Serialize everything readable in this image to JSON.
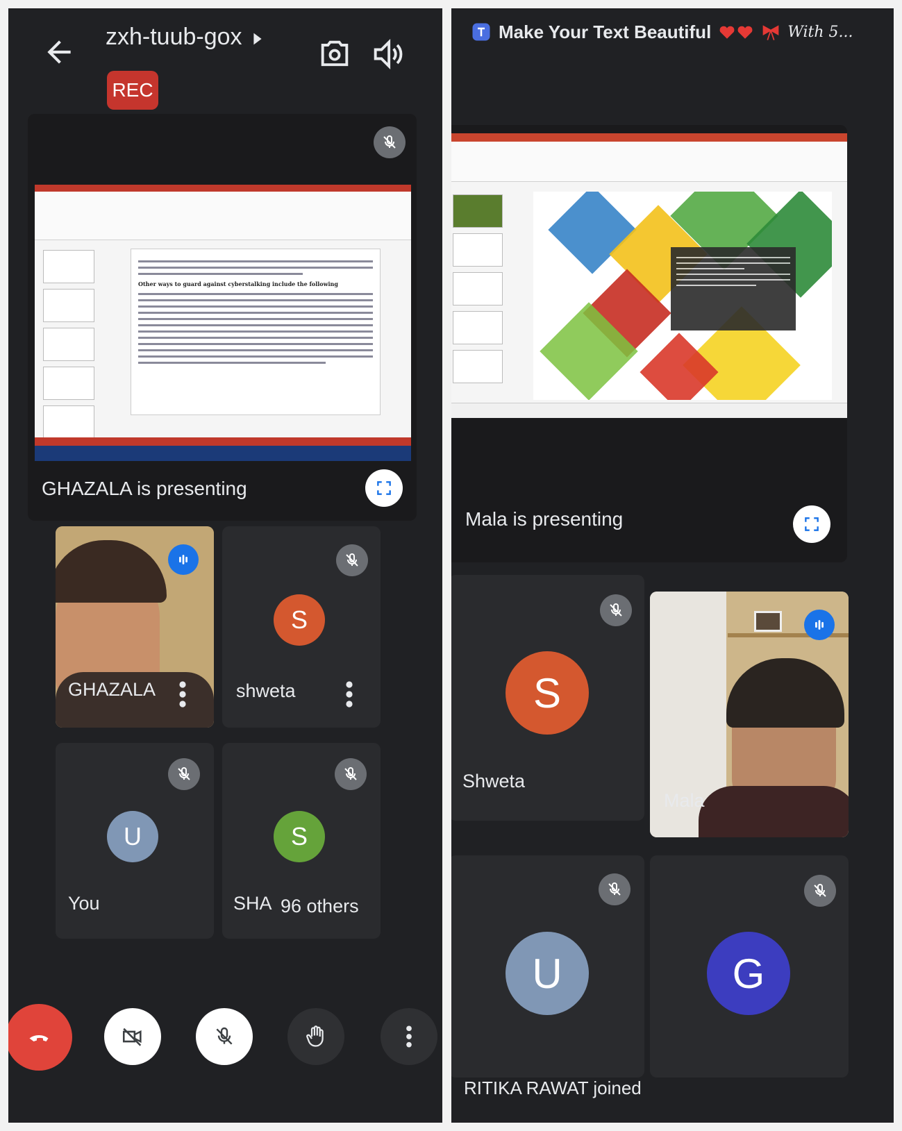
{
  "left": {
    "meeting_code": "zxh-tuub-gox",
    "rec_label": "REC",
    "presenting_label": "GHAZALA is presenting",
    "tiles": [
      {
        "name": "GHAZALA"
      },
      {
        "name": "shweta",
        "initial": "S",
        "color": "#d4582f"
      },
      {
        "name": "You",
        "initial": "U",
        "color": "#8097b5"
      },
      {
        "name": "SHA",
        "initial": "S",
        "color": "#65a33a",
        "others": "96 others"
      }
    ],
    "doc_heading": "Other ways to guard against cyberstalking include the following"
  },
  "right": {
    "notification_text": "Make Your Text Beautiful",
    "notification_extra": "With 5...",
    "presenting_label": "Mala is presenting",
    "tiles": [
      {
        "name": "Shweta",
        "initial": "S",
        "color": "#d4582f"
      },
      {
        "name": "Mala"
      },
      {
        "name": "",
        "initial": "U",
        "color": "#8097b5"
      },
      {
        "name": "",
        "initial": "G",
        "color": "#3c3dbf"
      }
    ],
    "toast": "RITIKA RAWAT joined"
  }
}
